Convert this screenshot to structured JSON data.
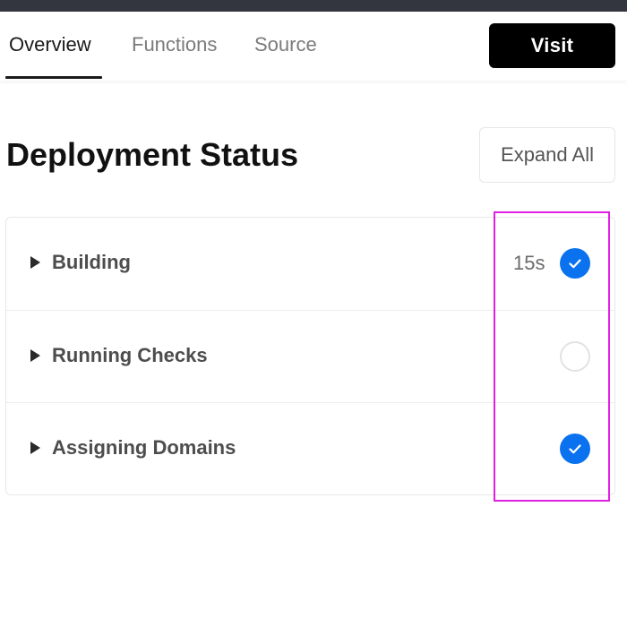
{
  "tabs": [
    {
      "label": "Overview",
      "active": true
    },
    {
      "label": "Functions",
      "active": false
    },
    {
      "label": "Source",
      "active": false
    }
  ],
  "visit_label": "Visit",
  "page_title": "Deployment Status",
  "expand_label": "Expand All",
  "steps": [
    {
      "label": "Building",
      "duration": "15s",
      "status": "complete"
    },
    {
      "label": "Running Checks",
      "duration": "",
      "status": "pending"
    },
    {
      "label": "Assigning Domains",
      "duration": "",
      "status": "complete"
    }
  ],
  "colors": {
    "accent": "#0a72ef",
    "highlight": "#e020e0",
    "top_strip": "#33353f"
  }
}
